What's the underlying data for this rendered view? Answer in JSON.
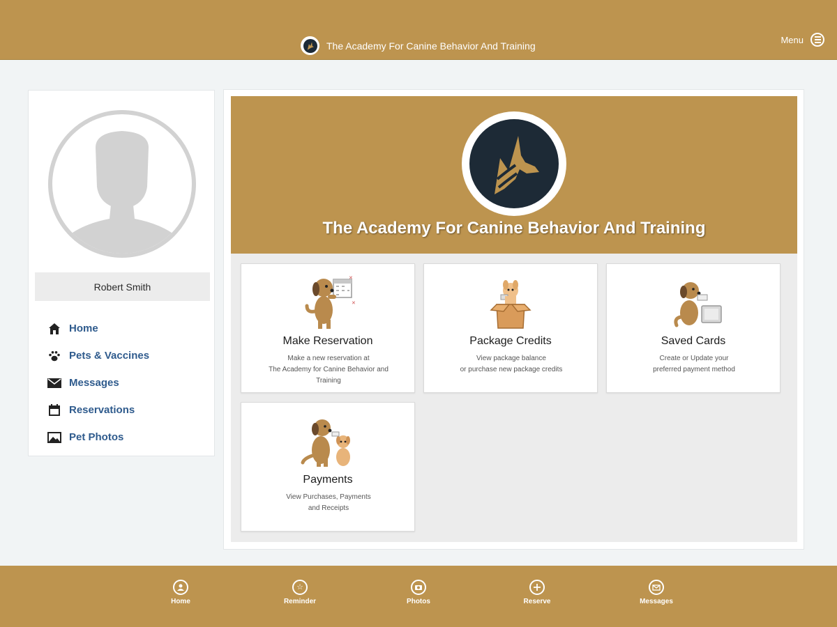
{
  "header": {
    "brand_title": "The Academy For Canine Behavior And Training",
    "menu_label": "Menu"
  },
  "sidebar": {
    "user_name": "Robert Smith",
    "nav": [
      {
        "label": "Home",
        "icon": "home-icon"
      },
      {
        "label": "Pets & Vaccines",
        "icon": "paw-icon"
      },
      {
        "label": "Messages",
        "icon": "envelope-icon"
      },
      {
        "label": "Reservations",
        "icon": "calendar-icon"
      },
      {
        "label": "Pet Photos",
        "icon": "photo-icon"
      }
    ]
  },
  "hero": {
    "title": "The Academy For Canine Behavior And Training"
  },
  "cards": [
    {
      "title": "Make Reservation",
      "description": "Make a new reservation at\nThe Academy for Canine Behavior and\nTraining",
      "icon": "dog-calendar-icon"
    },
    {
      "title": "Package Credits",
      "description": "View package balance\nor purchase new package credits",
      "icon": "dog-box-icon"
    },
    {
      "title": "Saved Cards",
      "description": "Create or Update your\npreferred payment method",
      "icon": "dog-card-icon"
    },
    {
      "title": "Payments",
      "description": "View Purchases, Payments\nand Receipts",
      "icon": "dog-puppy-icon"
    }
  ],
  "bottom_nav": [
    {
      "label": "Home",
      "icon": "home-circle-icon"
    },
    {
      "label": "Reminder",
      "icon": "star-circle-icon"
    },
    {
      "label": "Photos",
      "icon": "camera-circle-icon"
    },
    {
      "label": "Reserve",
      "icon": "plus-circle-icon"
    },
    {
      "label": "Messages",
      "icon": "envelope-circle-icon"
    }
  ],
  "colors": {
    "brand_gold": "#bd944f",
    "navy": "#1d2a36",
    "link_blue": "#2f5b8d",
    "background": "#f1f4f5",
    "dog_brown": "#b98a4d"
  }
}
